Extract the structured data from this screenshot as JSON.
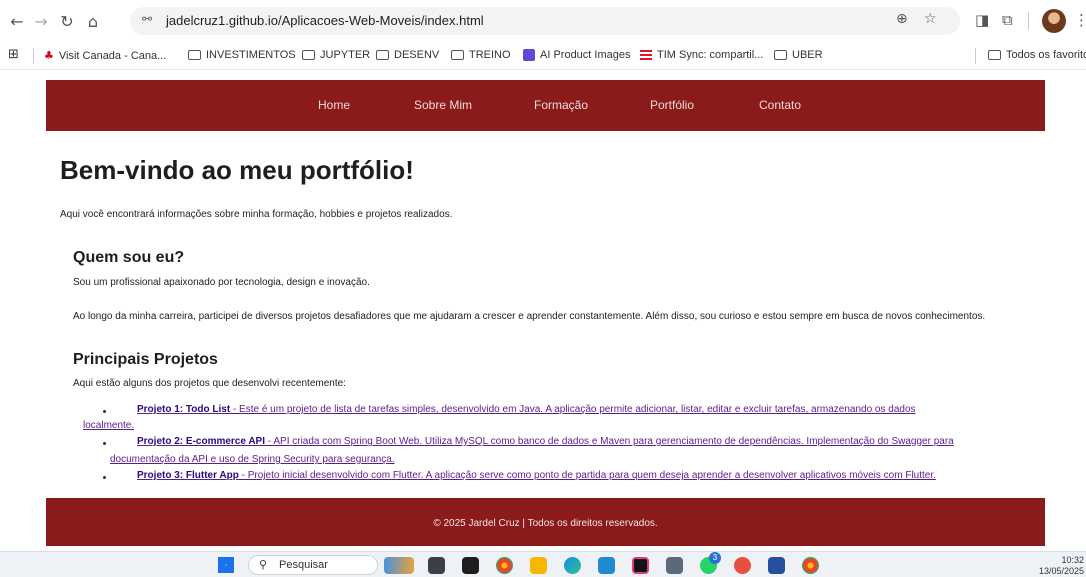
{
  "browser": {
    "url": "jadelcruz1.github.io/Aplicacoes-Web-Moveis/index.html",
    "icons": [
      "back-icon",
      "forward-icon",
      "reload-icon",
      "home-icon",
      "site-info-icon",
      "zoom-icon",
      "star-icon",
      "extensions-icon",
      "profile-avatar"
    ]
  },
  "bookmarks": [
    {
      "label": "Visit Canada - Cana..."
    },
    {
      "label": "INVESTIMENTOS"
    },
    {
      "label": "JUPYTER"
    },
    {
      "label": "DESENV"
    },
    {
      "label": "TREINO"
    },
    {
      "label": "AI Product Images"
    },
    {
      "label": "TIM Sync: compartil..."
    },
    {
      "label": "UBER"
    },
    {
      "label": "Todos os favoritos"
    }
  ],
  "nav": {
    "items": [
      "Home",
      "Sobre Mim",
      "Formação",
      "Portfólio",
      "Contato"
    ]
  },
  "hero": {
    "title": "Bem-vindo ao meu portfólio!",
    "intro": "Aqui você encontrará informações sobre minha formação, hobbies e projetos realizados."
  },
  "about": {
    "title": "Quem sou eu?",
    "p1": "Sou um profissional apaixonado por tecnologia, design e inovação.",
    "p2": "Ao longo da minha carreira, participei de diversos projetos desafiadores que me ajudaram a crescer e aprender constantemente. Além disso, sou curioso e estou sempre em busca de novos conhecimentos."
  },
  "projects": {
    "title": "Principais Projetos",
    "intro": "Aqui estão alguns dos projetos que desenvolvi recentemente:",
    "items": [
      {
        "title": "Projeto 1: Todo List",
        "desc1": " - Este é um projeto de lista de tarefas simples, desenvolvido em Java. A aplicação permite adicionar, listar, editar e excluir tarefas, armazenando os dados",
        "desc2": "localmente."
      },
      {
        "title": "Projeto 2: E-commerce API",
        "desc1": " - API criada com Spring Boot Web. Utiliza MySQL como banco de dados e Maven para gerenciamento de dependências. Implementação do Swagger para",
        "desc2": "documentação da API e uso de Spring Security para segurança."
      },
      {
        "title": "Projeto 3: Flutter App",
        "desc1": " - Projeto inicial desenvolvido com Flutter. A aplicação serve como ponto de partida para quem deseja aprender a desenvolver aplicativos móveis com Flutter.",
        "desc2": ""
      }
    ]
  },
  "footer": {
    "text": "© 2025 Jardel Cruz | Todos os direitos reservados."
  },
  "taskbar": {
    "search_label": "Pesquisar",
    "time": "10:32",
    "date": "13/05/2025",
    "chat_badge": "3"
  }
}
